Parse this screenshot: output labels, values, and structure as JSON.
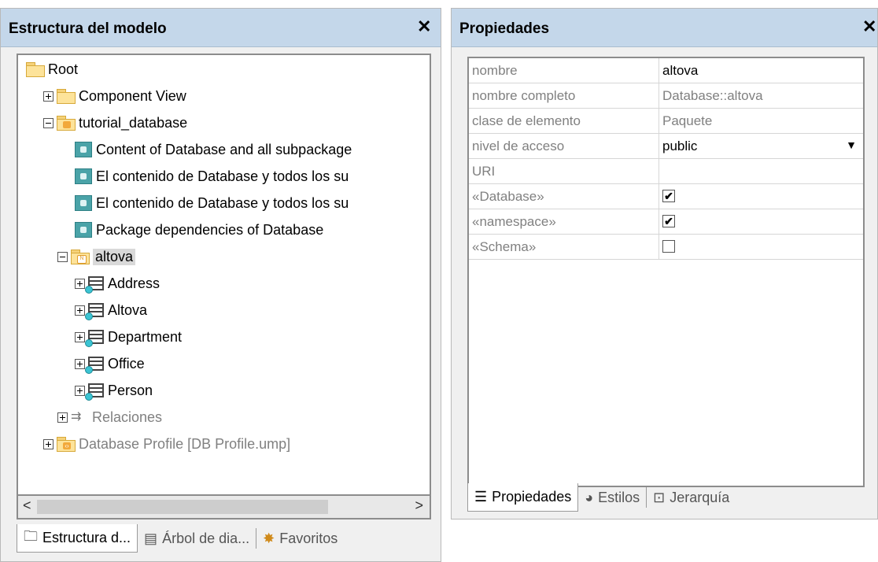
{
  "left_pane": {
    "title": "Estructura del modelo",
    "close": "✕",
    "tree": {
      "root": "Root",
      "component_view": "Component View",
      "tutorial_database": "tutorial_database",
      "diag1": "Content of Database and all subpackage",
      "diag2": "El contenido de Database y todos los su",
      "diag3": "El contenido de Database y todos los su",
      "diag4": "Package dependencies of Database",
      "altova": "altova",
      "tables": [
        "Address",
        "Altova",
        "Department",
        "Office",
        "Person"
      ],
      "relaciones": "Relaciones",
      "db_profile": "Database Profile [DB Profile.ump]"
    },
    "scroll": {
      "left": "<",
      "right": ">"
    },
    "tabs": [
      "Estructura d...",
      "Árbol de dia...",
      "Favoritos"
    ]
  },
  "right_pane": {
    "title": "Propiedades",
    "close": "✕",
    "rows": [
      {
        "name": "nombre",
        "value": "altova"
      },
      {
        "name": "nombre completo",
        "value": "Database::altova"
      },
      {
        "name": "clase de elemento",
        "value": "Paquete"
      },
      {
        "name": "nivel de acceso",
        "value": "public",
        "dropdown": "▼"
      },
      {
        "name": "URI",
        "value": ""
      },
      {
        "name": "«Database»",
        "checked": true,
        "mark": "✔"
      },
      {
        "name": "«namespace»",
        "checked": true,
        "mark": "✔"
      },
      {
        "name": "«Schema»",
        "checked": false,
        "mark": ""
      }
    ],
    "tabs": [
      "Propiedades",
      "Estilos",
      "Jerarquía"
    ]
  }
}
